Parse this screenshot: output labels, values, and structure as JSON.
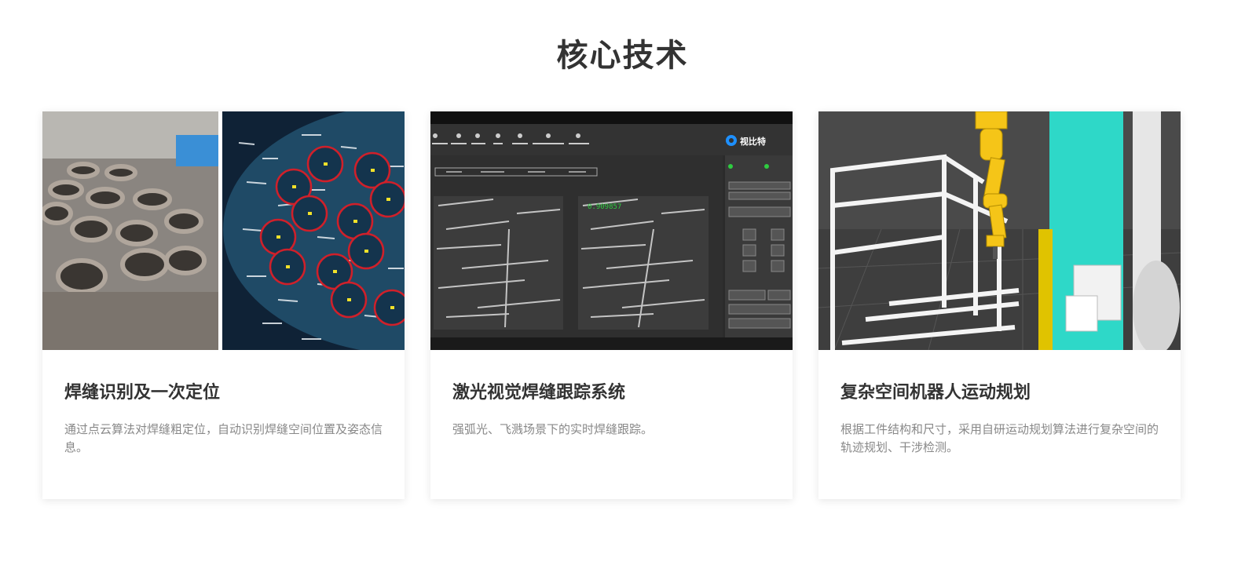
{
  "section": {
    "title": "核心技术"
  },
  "cards": [
    {
      "title": "焊缝识别及一次定位",
      "description": "通过点云算法对焊缝粗定位，自动识别焊缝空间位置及姿态信息。"
    },
    {
      "title": "激光视觉焊缝跟踪系统",
      "description": "强弧光、飞溅场景下的实时焊缝跟踪。",
      "screenshot": {
        "brand": "视比特",
        "overlay_value": "0.909857"
      }
    },
    {
      "title": "复杂空间机器人运动规划",
      "description": "根据工件结构和尺寸，采用自研运动规划算法进行复杂空间的轨迹规划、干涉检测。"
    }
  ],
  "colors": {
    "accent_cyan": "#2ed8c8",
    "robot_yellow": "#f5c518",
    "weld_circle_red": "#d0202a"
  }
}
